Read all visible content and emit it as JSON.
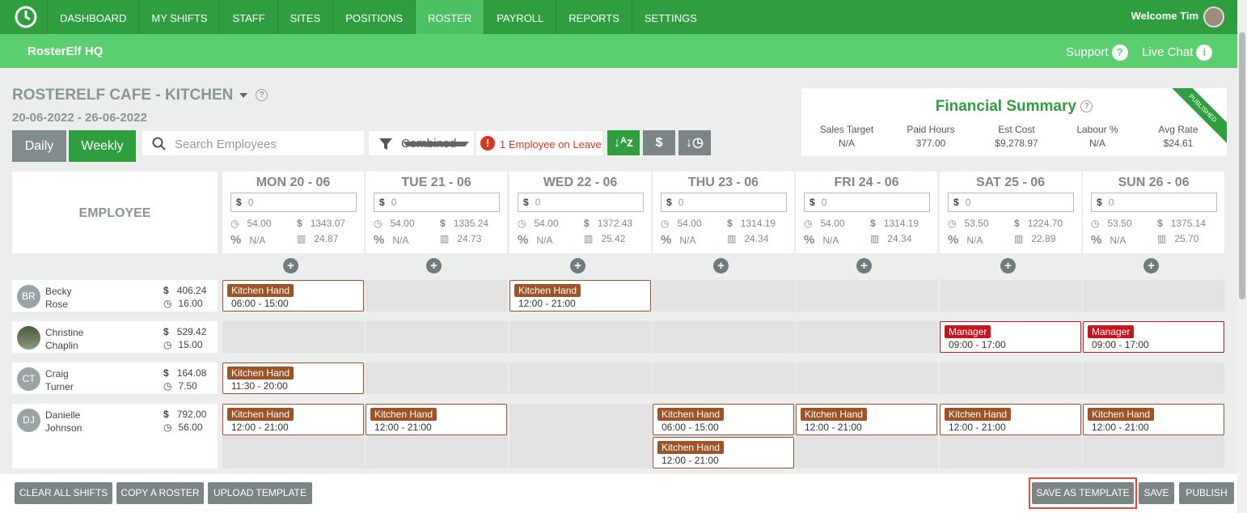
{
  "nav": {
    "items": [
      "DASHBOARD",
      "MY SHIFTS",
      "STAFF",
      "SITES",
      "POSITIONS",
      "ROSTER",
      "PAYROLL",
      "REPORTS",
      "SETTINGS"
    ],
    "active": "ROSTER",
    "welcome": "Welcome Tim"
  },
  "subbar": {
    "org": "RosterElf HQ",
    "support": "Support",
    "livechat": "Live Chat"
  },
  "roster": {
    "title": "ROSTERELF CAFE - KITCHEN",
    "date_range": "20-06-2022 - 26-06-2022"
  },
  "toolbar": {
    "daily": "Daily",
    "weekly": "Weekly",
    "search_placeholder": "Search Employees",
    "filter": "Combined",
    "leave": "1 Employee on Leave"
  },
  "financial": {
    "title": "Financial Summary",
    "badge": "PUBLISHED",
    "metrics": [
      {
        "label": "Sales Target",
        "value": "N/A"
      },
      {
        "label": "Paid Hours",
        "value": "377.00"
      },
      {
        "label": "Est Cost",
        "value": "$9,278.97"
      },
      {
        "label": "Labour %",
        "value": "N/A"
      },
      {
        "label": "Avg Rate",
        "value": "$24.61"
      }
    ]
  },
  "grid": {
    "employee_header": "EMPLOYEE",
    "days": [
      {
        "name": "MON 20 - 06",
        "sales": "0",
        "hours": "54.00",
        "cost": "1343.07",
        "pct": "N/A",
        "rate": "24.87"
      },
      {
        "name": "TUE 21 - 06",
        "sales": "0",
        "hours": "54.00",
        "cost": "1335.24",
        "pct": "N/A",
        "rate": "24.73"
      },
      {
        "name": "WED 22 - 06",
        "sales": "0",
        "hours": "54.00",
        "cost": "1372.43",
        "pct": "N/A",
        "rate": "25.42"
      },
      {
        "name": "THU 23 - 06",
        "sales": "0",
        "hours": "54.00",
        "cost": "1314.19",
        "pct": "N/A",
        "rate": "24.34"
      },
      {
        "name": "FRI 24 - 06",
        "sales": "0",
        "hours": "54.00",
        "cost": "1314.19",
        "pct": "N/A",
        "rate": "24.34"
      },
      {
        "name": "SAT 25 - 06",
        "sales": "0",
        "hours": "53.50",
        "cost": "1224.70",
        "pct": "N/A",
        "rate": "22.89"
      },
      {
        "name": "SUN 26 - 06",
        "sales": "0",
        "hours": "53.50",
        "cost": "1375.14",
        "pct": "N/A",
        "rate": "25.70"
      }
    ]
  },
  "employees": [
    {
      "initials": "BR",
      "first": "Becky",
      "last": "Rose",
      "cost": "406.24",
      "hours": "16.00"
    },
    {
      "initials": "",
      "first": "Christine",
      "last": "Chaplin",
      "cost": "529.42",
      "hours": "15.00"
    },
    {
      "initials": "CT",
      "first": "Craig",
      "last": "Turner",
      "cost": "164.08",
      "hours": "7.50"
    },
    {
      "initials": "DJ",
      "first": "Danielle",
      "last": "Johnson",
      "cost": "792.00",
      "hours": "56.00"
    }
  ],
  "shifts": [
    {
      "emp": 0,
      "day": 0,
      "role": "Kitchen Hand",
      "time": "06:00 - 15:00"
    },
    {
      "emp": 0,
      "day": 2,
      "role": "Kitchen Hand",
      "time": "12:00 - 21:00"
    },
    {
      "emp": 1,
      "day": 5,
      "role": "Manager",
      "time": "09:00 - 17:00"
    },
    {
      "emp": 1,
      "day": 6,
      "role": "Manager",
      "time": "09:00 - 17:00"
    },
    {
      "emp": 2,
      "day": 0,
      "role": "Kitchen Hand",
      "time": "11:30 - 20:00"
    },
    {
      "emp": 3,
      "day": 0,
      "role": "Kitchen Hand",
      "time": "12:00 - 21:00"
    },
    {
      "emp": 3,
      "day": 1,
      "role": "Kitchen Hand",
      "time": "12:00 - 21:00"
    },
    {
      "emp": 3,
      "day": 3,
      "role": "Kitchen Hand",
      "time": "06:00 - 15:00"
    },
    {
      "emp": 3,
      "day": 3,
      "role": "Kitchen Hand",
      "time": "12:00 - 21:00"
    },
    {
      "emp": 3,
      "day": 4,
      "role": "Kitchen Hand",
      "time": "12:00 - 21:00"
    },
    {
      "emp": 3,
      "day": 5,
      "role": "Kitchen Hand",
      "time": "12:00 - 21:00"
    },
    {
      "emp": 3,
      "day": 6,
      "role": "Kitchen Hand",
      "time": "12:00 - 21:00"
    }
  ],
  "footer": {
    "clear": "CLEAR ALL SHIFTS",
    "copy": "COPY A ROSTER",
    "upload": "UPLOAD TEMPLATE",
    "save_template": "SAVE AS TEMPLATE",
    "save": "SAVE",
    "publish": "PUBLISH"
  }
}
